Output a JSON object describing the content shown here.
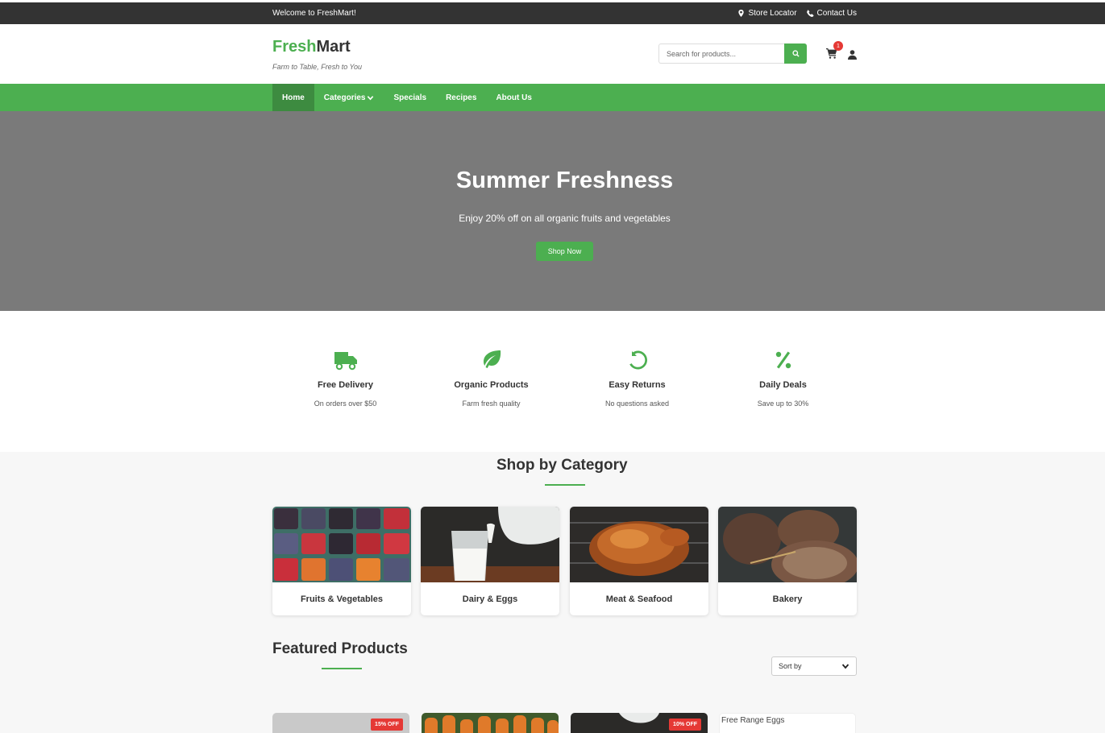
{
  "topbar": {
    "welcome": "Welcome to FreshMart!",
    "store_locator": "Store Locator",
    "contact_us": "Contact Us"
  },
  "header": {
    "logo_fresh": "Fresh",
    "logo_mart": "Mart",
    "tagline": "Farm to Table, Fresh to You",
    "search_placeholder": "Search for products...",
    "cart_count": "1"
  },
  "nav": {
    "items": [
      "Home",
      "Categories",
      "Specials",
      "Recipes",
      "About Us"
    ],
    "active": "Home"
  },
  "hero": {
    "title": "Summer Freshness",
    "subtitle": "Enjoy 20% off on all organic fruits and vegetables",
    "button": "Shop Now"
  },
  "features": [
    {
      "icon": "truck-icon",
      "title": "Free Delivery",
      "text": "On orders over $50"
    },
    {
      "icon": "leaf-icon",
      "title": "Organic Products",
      "text": "Farm fresh quality"
    },
    {
      "icon": "undo-icon",
      "title": "Easy Returns",
      "text": "No questions asked"
    },
    {
      "icon": "percent-icon",
      "title": "Daily Deals",
      "text": "Save up to 30%"
    }
  ],
  "categories": {
    "title": "Shop by Category",
    "items": [
      "Fruits & Vegetables",
      "Dairy & Eggs",
      "Meat & Seafood",
      "Bakery"
    ]
  },
  "featured": {
    "title": "Featured Products",
    "sort_label": "Sort by",
    "products": [
      {
        "badge": "15% OFF"
      },
      {
        "badge": ""
      },
      {
        "badge": "10% OFF"
      },
      {
        "alt": "Free Range Eggs"
      }
    ]
  },
  "colors": {
    "accent": "#4CAF50",
    "dark": "#333333",
    "hero_bg": "#7a7a7a",
    "sale": "#e53935"
  }
}
